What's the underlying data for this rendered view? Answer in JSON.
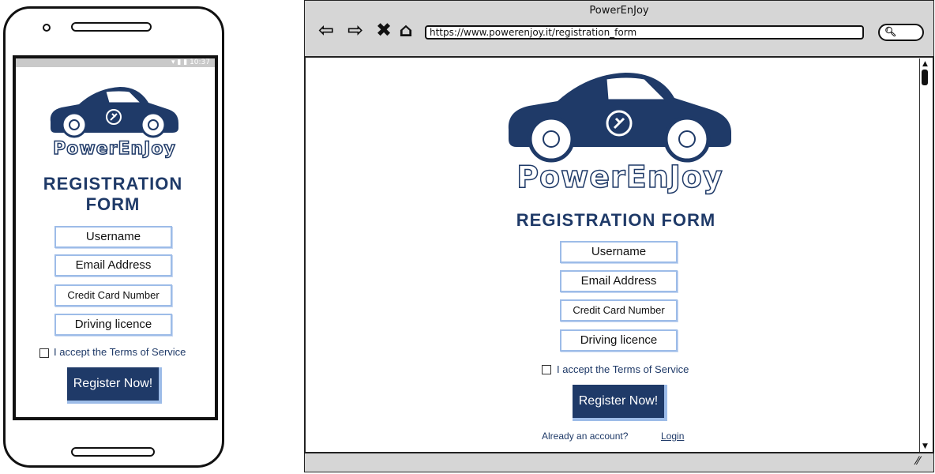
{
  "phone": {
    "status_time": "10:37",
    "brand": "PowerEnJoy",
    "title_line1": "REGISTRATION",
    "title_line2": "FORM",
    "fields": {
      "username": "Username",
      "email": "Email Address",
      "credit_card": "Credit Card Number",
      "driving_licence": "Driving licence"
    },
    "terms_label": "I accept the Terms of Service",
    "register_button": "Register Now!"
  },
  "browser": {
    "window_title": "PowerEnJoy",
    "url": "https://www.powerenjoy.it/registration_form",
    "brand": "PowerEnJoy",
    "title": "REGISTRATION FORM",
    "fields": {
      "username": "Username",
      "email": "Email Address",
      "credit_card": "Credit Card Number",
      "driving_licence": "Driving licence"
    },
    "terms_label": "I accept the Terms of Service",
    "register_button": "Register Now!",
    "already_account": "Already an account?",
    "login_link": "Login"
  },
  "icons": [
    "back-arrow-icon",
    "forward-arrow-icon",
    "close-icon",
    "home-icon",
    "search-icon",
    "car-logo-icon",
    "plug-icon",
    "checkbox-icon"
  ],
  "colors": {
    "brand_navy": "#1f3a68",
    "field_border": "#9dbce8",
    "chrome_gray": "#d6d6d6"
  }
}
